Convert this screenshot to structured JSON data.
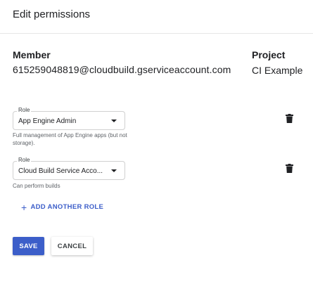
{
  "dialog": {
    "title": "Edit permissions"
  },
  "member": {
    "heading": "Member",
    "value": "615259048819@cloudbuild.gserviceaccount.com"
  },
  "project": {
    "heading": "Project",
    "value": "CI Example"
  },
  "roles": [
    {
      "label": "Role",
      "value": "App Engine Admin",
      "description": "Full management of App Engine apps (but not storage).",
      "delete_icon": "trash-icon"
    },
    {
      "label": "Role",
      "value": "Cloud Build Service Acco...",
      "description": "Can perform builds",
      "delete_icon": "trash-icon"
    }
  ],
  "actions": {
    "add_role_icon": "plus-icon",
    "add_role_label": "ADD ANOTHER ROLE",
    "save_label": "SAVE",
    "cancel_label": "CANCEL"
  },
  "colors": {
    "accent": "#3c5ec9",
    "text": "#202124",
    "muted": "#5f6368"
  }
}
